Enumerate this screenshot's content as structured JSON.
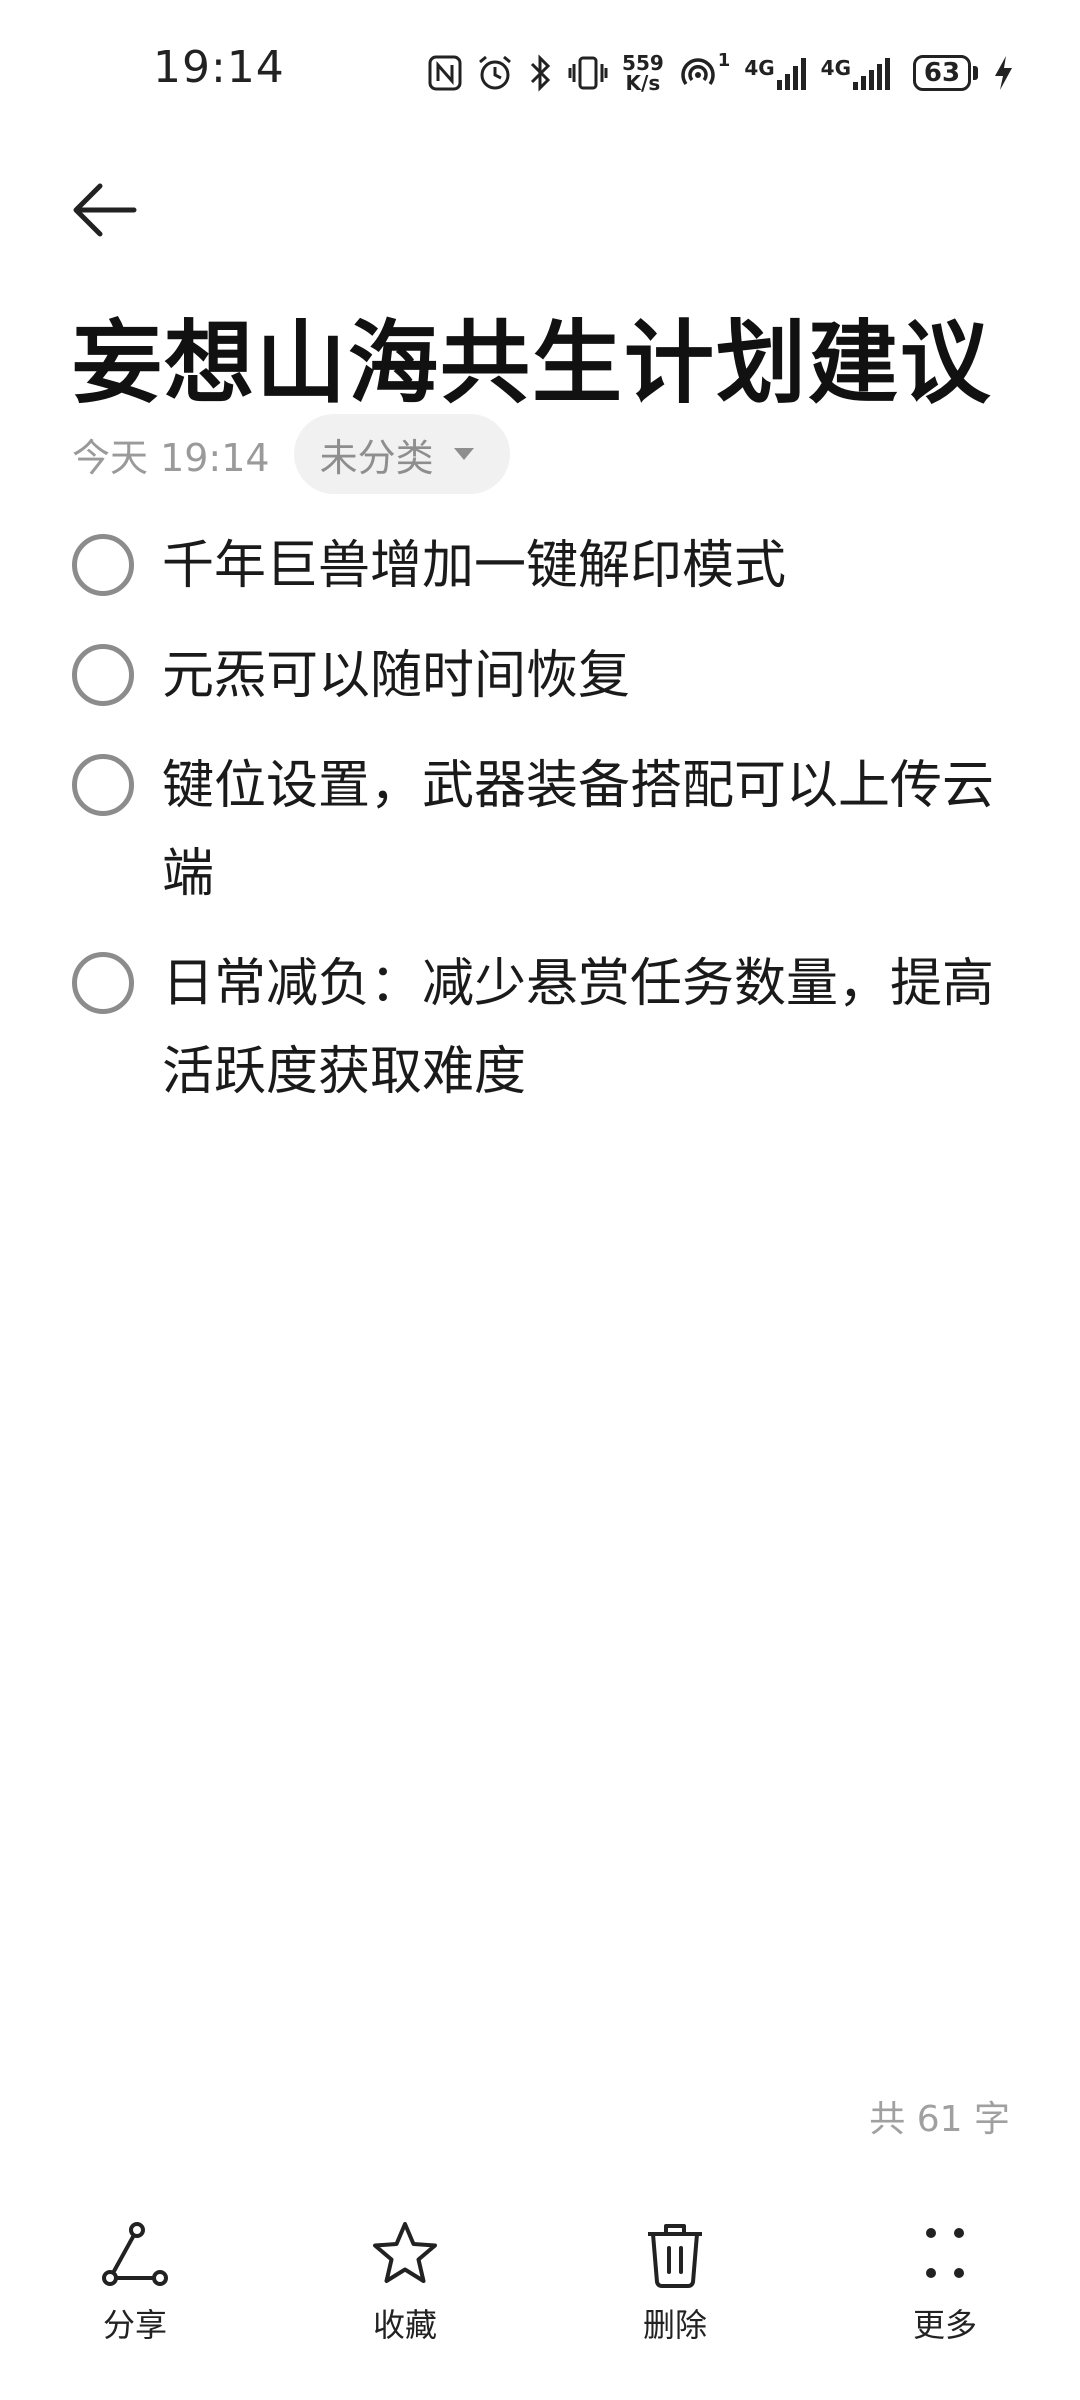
{
  "status_bar": {
    "time": "19:14",
    "speed_value": "559",
    "speed_unit": "K/s",
    "hotspot_count": "1",
    "network1": "4G",
    "network2": "4G",
    "battery": "63"
  },
  "note": {
    "title": "妄想山海共生计划建议",
    "date": "今天 19:14",
    "category": "未分类",
    "items": [
      {
        "text": "千年巨兽增加一键解印模式",
        "checked": false
      },
      {
        "text": "元炁可以随时间恢复",
        "checked": false
      },
      {
        "text": "键位设置，武器装备搭配可以上传云端",
        "checked": false
      },
      {
        "text": "日常减负：减少悬赏任务数量，提高活跃度获取难度",
        "checked": false
      }
    ],
    "word_count": "共 61 字"
  },
  "toolbar": {
    "share": "分享",
    "favorite": "收藏",
    "delete": "删除",
    "more": "更多"
  },
  "icons": {
    "back": "arrow-left-icon",
    "share": "share-icon",
    "favorite": "star-icon",
    "delete": "trash-icon",
    "more": "dots-grid-icon",
    "category": "triangle-down-icon"
  }
}
